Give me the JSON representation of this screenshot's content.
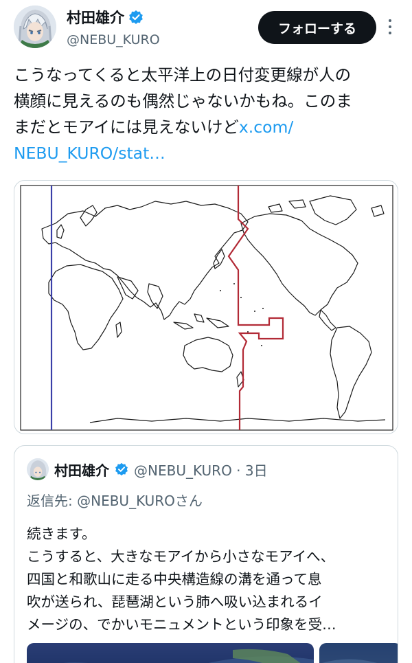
{
  "author": {
    "display_name": "村田雄介",
    "handle": "@NEBU_KURO"
  },
  "actions": {
    "follow_label": "フォローする"
  },
  "tweet": {
    "lines": [
      "こうなってくると太平洋上の日付変更線が人の",
      "横顔に見えるのも偶然じゃないかもね。このま",
      "まだとモアイには見えないけど"
    ],
    "link_part1": "x.com/",
    "link_part2": "NEBU_KURO/stat…"
  },
  "colors": {
    "accent": "#1d9bf0",
    "verified": "#1d9bf0",
    "dateline_red": "#b22a36",
    "meridian_blue": "#3a3fa8",
    "follow_bg": "#0f1419"
  },
  "quote": {
    "display_name": "村田雄介",
    "handle_time": "@NEBU_KURO · 3日",
    "reply_prefix": "返信先: ",
    "reply_mention": "@NEBU_KUROさん",
    "lines": [
      "続きます。",
      "こうすると、大きなモアイから小さなモアイへ、",
      "四国と和歌山に走る中央構造線の溝を通って息",
      "吹が送られ、琵琶湖という肺へ吸い込まれるイ",
      "メージの、でかいモニュメントという印象を受…"
    ]
  }
}
